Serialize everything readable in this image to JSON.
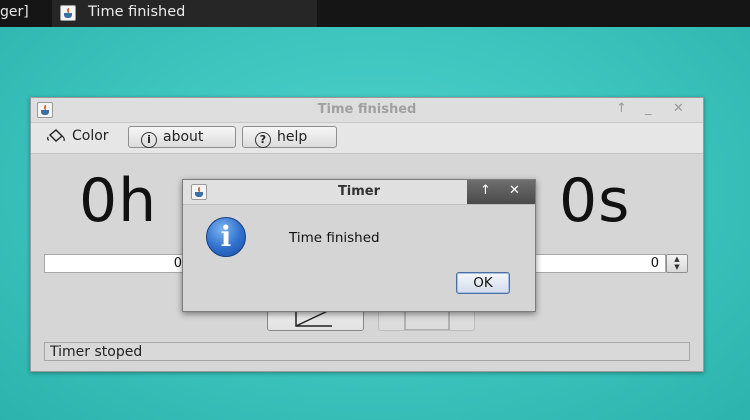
{
  "taskbar": {
    "left_fragment": "ger]",
    "window_title": "Time finished"
  },
  "main_window": {
    "title": "Time finished",
    "controls": {
      "restore": "↑",
      "minimize": "_",
      "close": "✕"
    },
    "toolbar": {
      "color_label": "Color",
      "about_label": "about",
      "help_label": "help"
    },
    "time_display": {
      "hours": "0h",
      "seconds": "0s"
    },
    "spinners": {
      "hours_value": "0",
      "seconds_value": "0"
    },
    "status": "Timer stoped"
  },
  "dialog": {
    "title": "Timer",
    "message": "Time finished",
    "ok_label": "OK",
    "controls": {
      "restore": "↑",
      "close": "✕"
    }
  },
  "icons": {
    "app": "java-cup-icon",
    "color": "paint-bucket-icon",
    "about": "info-circle-icon",
    "help": "question-circle-icon",
    "message": "info-icon",
    "play": "play-icon",
    "stop": "stop-icon"
  },
  "colors": {
    "desktop": "#3ec6bf",
    "taskbar": "#151515",
    "window_bg": "#d6d6d6",
    "info_blue": "#2f6fcc"
  }
}
